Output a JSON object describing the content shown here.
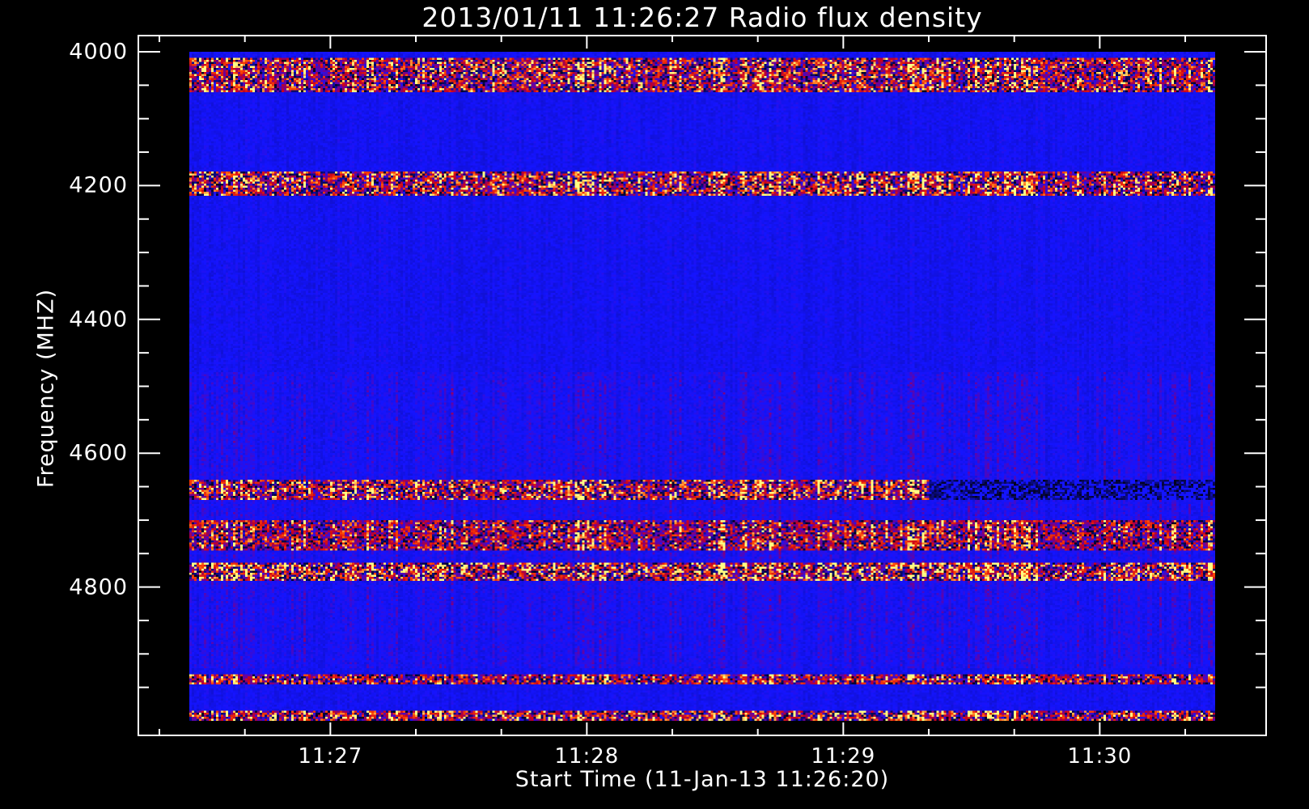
{
  "chart_data": {
    "type": "heatmap",
    "title": "2013/01/11 11:26:27 Radio flux density",
    "xlabel": "Start Time (11-Jan-13 11:26:20)",
    "ylabel": "Frequency (MHZ)",
    "x_range_seconds": [
      27,
      267
    ],
    "x_origin_label": "11:26:00",
    "x_major_ticks": [
      {
        "t": 60,
        "label": "11:27"
      },
      {
        "t": 120,
        "label": "11:28"
      },
      {
        "t": 180,
        "label": "11:29"
      },
      {
        "t": 240,
        "label": "11:30"
      }
    ],
    "x_minor_step_seconds": 20,
    "ylim": [
      4000,
      5000
    ],
    "y_reversed": true,
    "y_major_ticks": [
      4000,
      4200,
      4400,
      4600,
      4800
    ],
    "y_minor_step": 50,
    "colormap": [
      "#000000",
      "#0000ff",
      "#c00030",
      "#ff4000",
      "#ffff80"
    ],
    "background_level": 0.5,
    "bands": [
      {
        "fmin": 4010,
        "fmax": 4060,
        "level": 0.78,
        "dark": true
      },
      {
        "fmin": 4180,
        "fmax": 4215,
        "level": 0.8,
        "dark": true
      },
      {
        "fmin": 4640,
        "fmax": 4670,
        "level": 0.8,
        "dark": true
      },
      {
        "fmin": 4700,
        "fmax": 4745,
        "level": 0.72,
        "dark": true
      },
      {
        "fmin": 4765,
        "fmax": 4790,
        "level": 0.85,
        "dark": true
      },
      {
        "fmin": 4930,
        "fmax": 4945,
        "level": 0.75,
        "dark": true
      },
      {
        "fmin": 4985,
        "fmax": 5000,
        "level": 0.8,
        "dark": true
      }
    ],
    "diffuse_region": {
      "fmin": 4480,
      "fmax": 4920,
      "level": 0.6
    }
  }
}
